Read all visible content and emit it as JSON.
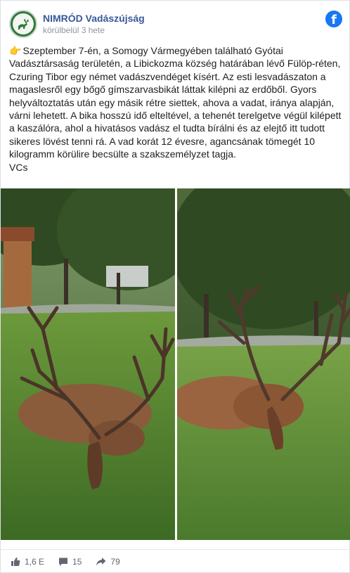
{
  "post": {
    "page_name": "NIMRÓD Vadászújság",
    "timestamp": "körülbelül 3 hete",
    "text": "Szeptember 7-én, a Somogy Vármegyében található Gyótai Vadásztársaság területén, a Libickozma község határában lévő Fülöp-réten, Czuring Tibor egy német vadászvendéget kísért. Az esti lesvadászaton a magaslesről egy bőgő gímszarvasbikát láttak kilépni az erdőből. Gyors helyváltoztatás után egy másik rétre siettek, ahova a vadat, iránya alapján, várni lehetett. A bika hosszú idő elteltével, a tehenét terelgetve végül kilépett a kaszálóra, ahol a hivatásos vadász el tudta bírálni és az elejtő itt tudott sikeres lövést tenni rá. A vad korát 12 évesre, agancsának tömegét 10 kilogramm körülire becsülte a szakszemélyzet tagja.",
    "signature": "VCs",
    "text_icon": "pointing-hand-icon"
  },
  "stats": {
    "likes": "1,6 E",
    "comments": "15",
    "shares": "79"
  },
  "colors": {
    "brand": "#1877f2",
    "page_name": "#385898",
    "grass": "#4f7d2c"
  }
}
